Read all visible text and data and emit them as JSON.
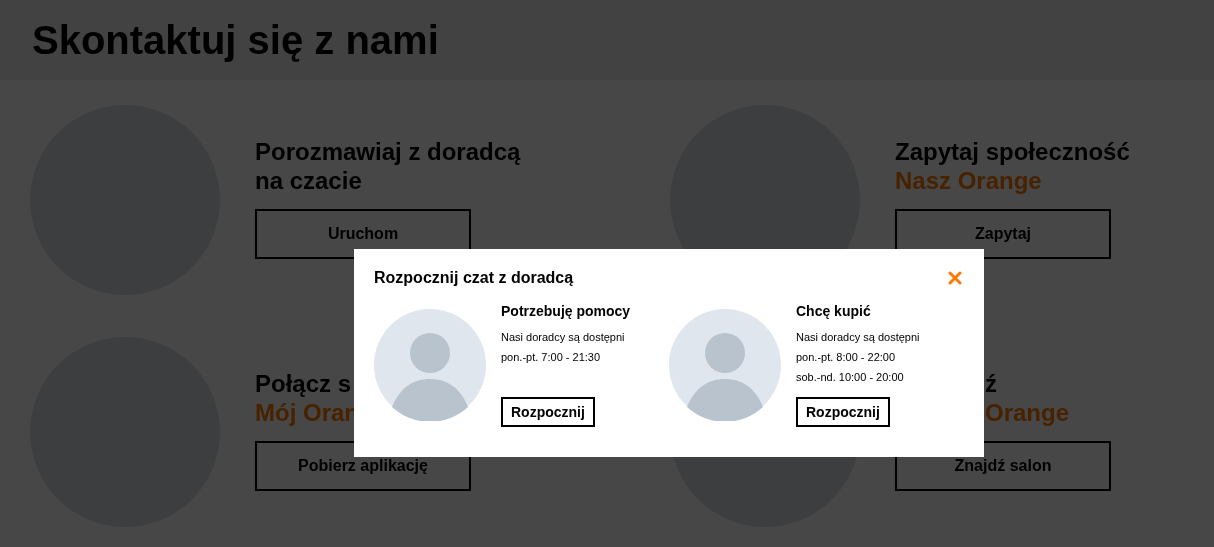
{
  "page_title": "Skontaktuj się z nami",
  "cards": [
    {
      "title": "Porozmawiaj z doradcą na czacie",
      "button": "Uruchom"
    },
    {
      "title": "Zapytaj społeczność",
      "highlight": "Nasz Orange",
      "button": "Zapytaj"
    },
    {
      "title": "Połącz s",
      "highlight": "Mój Oran",
      "button": "Pobierz aplikację"
    },
    {
      "title": "ź",
      "highlight": "Orange",
      "button": "Znajdź salon"
    }
  ],
  "modal": {
    "title": "Rozpocznij czat z doradcą",
    "advisors": [
      {
        "name": "Potrzebuję pomocy",
        "lines": [
          "Nasi doradcy są dostępni",
          "pon.-pt. 7:00 - 21:30"
        ],
        "button": "Rozpocznij"
      },
      {
        "name": "Chcę kupić",
        "lines": [
          "Nasi doradcy są dostępni",
          "pon.-pt. 8:00 - 22:00",
          "sob.-nd. 10:00 - 20:00"
        ],
        "button": "Rozpocznij"
      }
    ]
  }
}
